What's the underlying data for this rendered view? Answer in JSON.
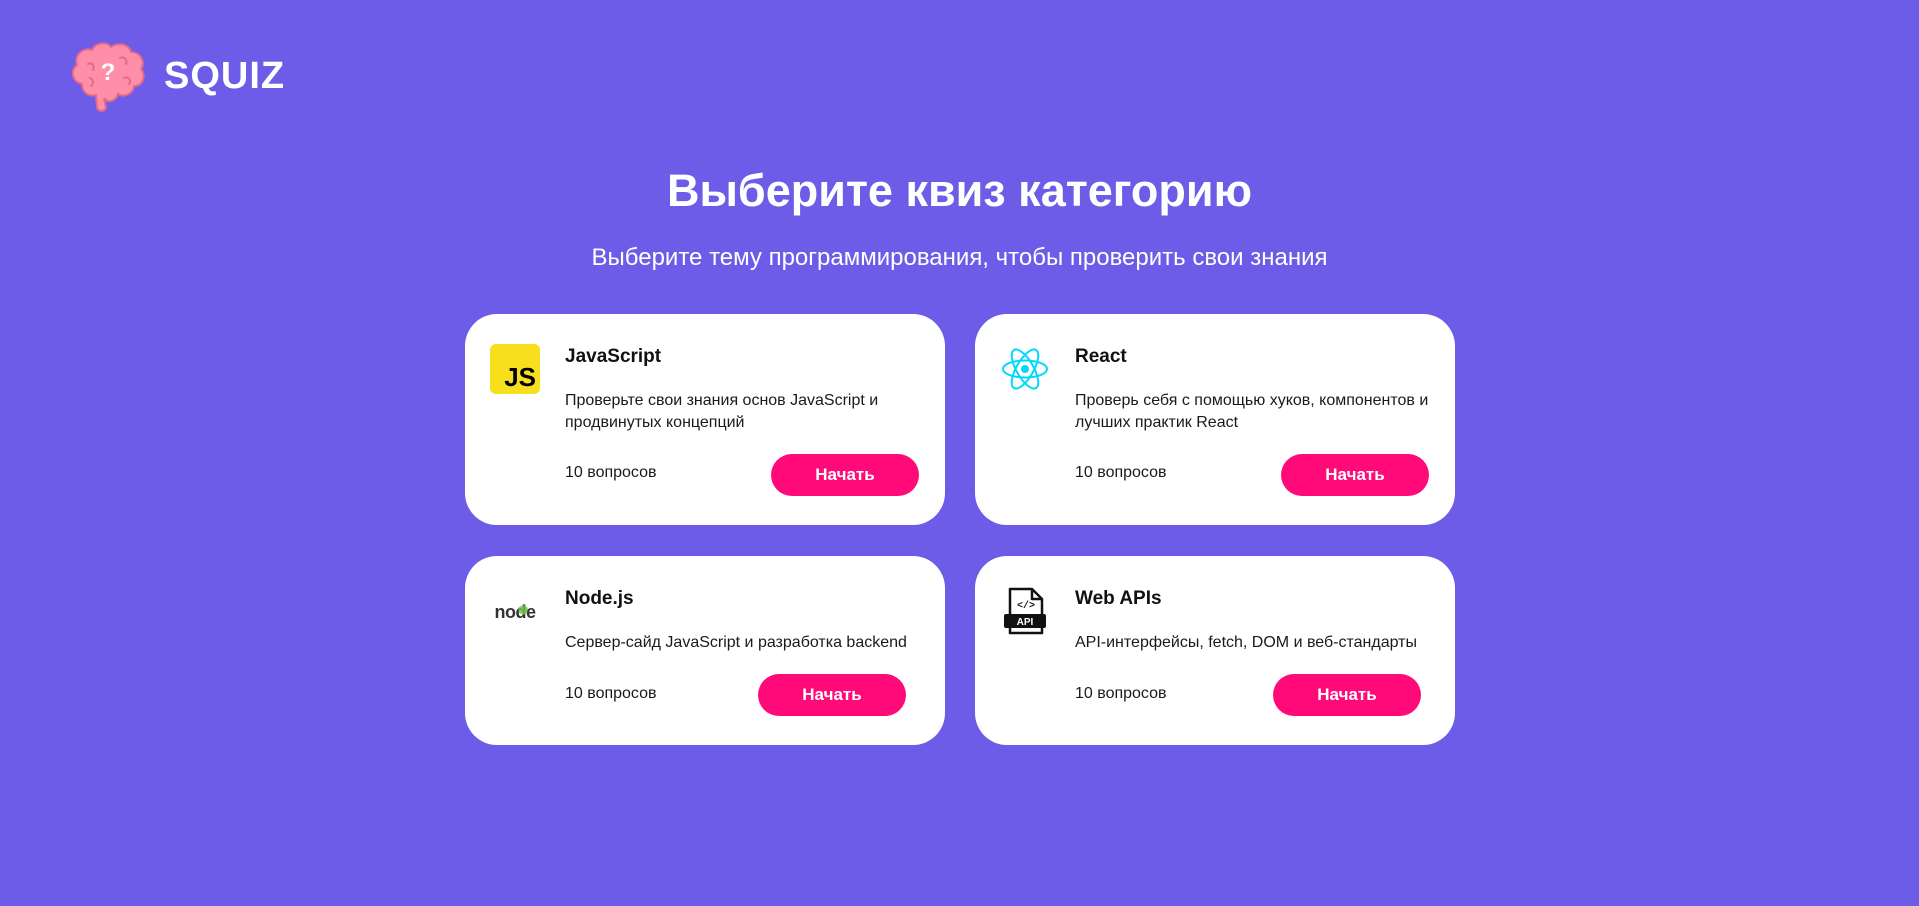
{
  "app": {
    "name": "SQUIZ"
  },
  "header": {
    "title": "Выберите квиз категорию",
    "subtitle": "Выберите тему программирования, чтобы проверить свои знания"
  },
  "colors": {
    "background": "#6C5CE7",
    "accent": "#FF0A78",
    "card": "#FFFFFF"
  },
  "categories": [
    {
      "icon": "javascript-icon",
      "icon_text": "JS",
      "title": "JavaScript",
      "description": "Проверьте свои знания основ JavaScript и продвинутых концепций",
      "count": "10 вопросов",
      "button": "Начать"
    },
    {
      "icon": "react-icon",
      "title": "React",
      "description": "Проверь себя с помощью хуков, компонентов и лучших практик React",
      "count": "10 вопросов",
      "button": "Начать"
    },
    {
      "icon": "nodejs-icon",
      "icon_text": "node",
      "title": "Node.js",
      "description": "Сервер-сайд JavaScript и разработка backend",
      "count": "10 вопросов",
      "button": "Начать"
    },
    {
      "icon": "web-api-icon",
      "icon_text": "API",
      "title": "Web APIs",
      "description": "API-интерфейсы, fetch, DOM и веб-стандарты",
      "count": "10 вопросов",
      "button": "Начать"
    }
  ]
}
